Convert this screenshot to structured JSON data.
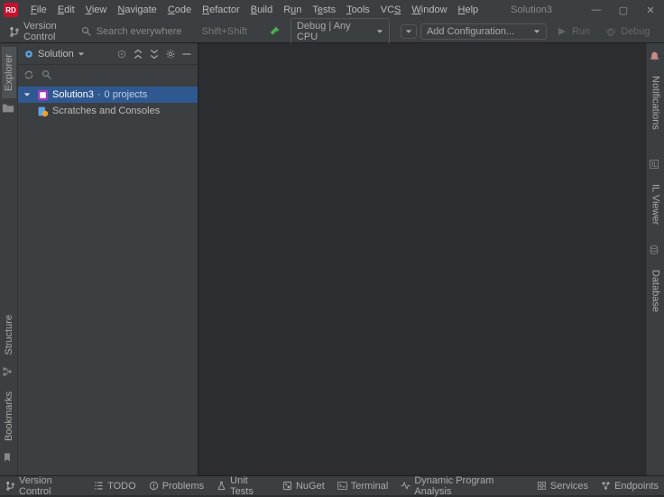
{
  "app": {
    "logo_text": "RD",
    "solution_name": "Solution3"
  },
  "menu": [
    "File",
    "Edit",
    "View",
    "Navigate",
    "Code",
    "Refactor",
    "Build",
    "Run",
    "Tests",
    "Tools",
    "VCS",
    "Window",
    "Help"
  ],
  "win": {
    "min": "—",
    "max": "▢",
    "close": "✕"
  },
  "toolbar": {
    "vc": "Version Control",
    "search_placeholder": "Search everywhere",
    "search_hint": "Shift+Shift",
    "config_label": "Debug | Any CPU",
    "add_config": "Add Configuration...",
    "run": "Run",
    "debug": "Debug"
  },
  "left_tabs": {
    "explorer": "Explorer",
    "structure": "Structure",
    "bookmarks": "Bookmarks"
  },
  "right_tabs": {
    "notifications": "Notifications",
    "il": "IL Viewer",
    "database": "Database"
  },
  "explorer": {
    "title": "Solution",
    "tree": {
      "root": {
        "name": "Solution3",
        "subtitle": "0 projects"
      },
      "scratches": "Scratches and Consoles"
    }
  },
  "status": {
    "vc": "Version Control",
    "todo": "TODO",
    "problems": "Problems",
    "unit": "Unit Tests",
    "nuget": "NuGet",
    "terminal": "Terminal",
    "dpa": "Dynamic Program Analysis",
    "services": "Services",
    "endpoints": "Endpoints"
  }
}
